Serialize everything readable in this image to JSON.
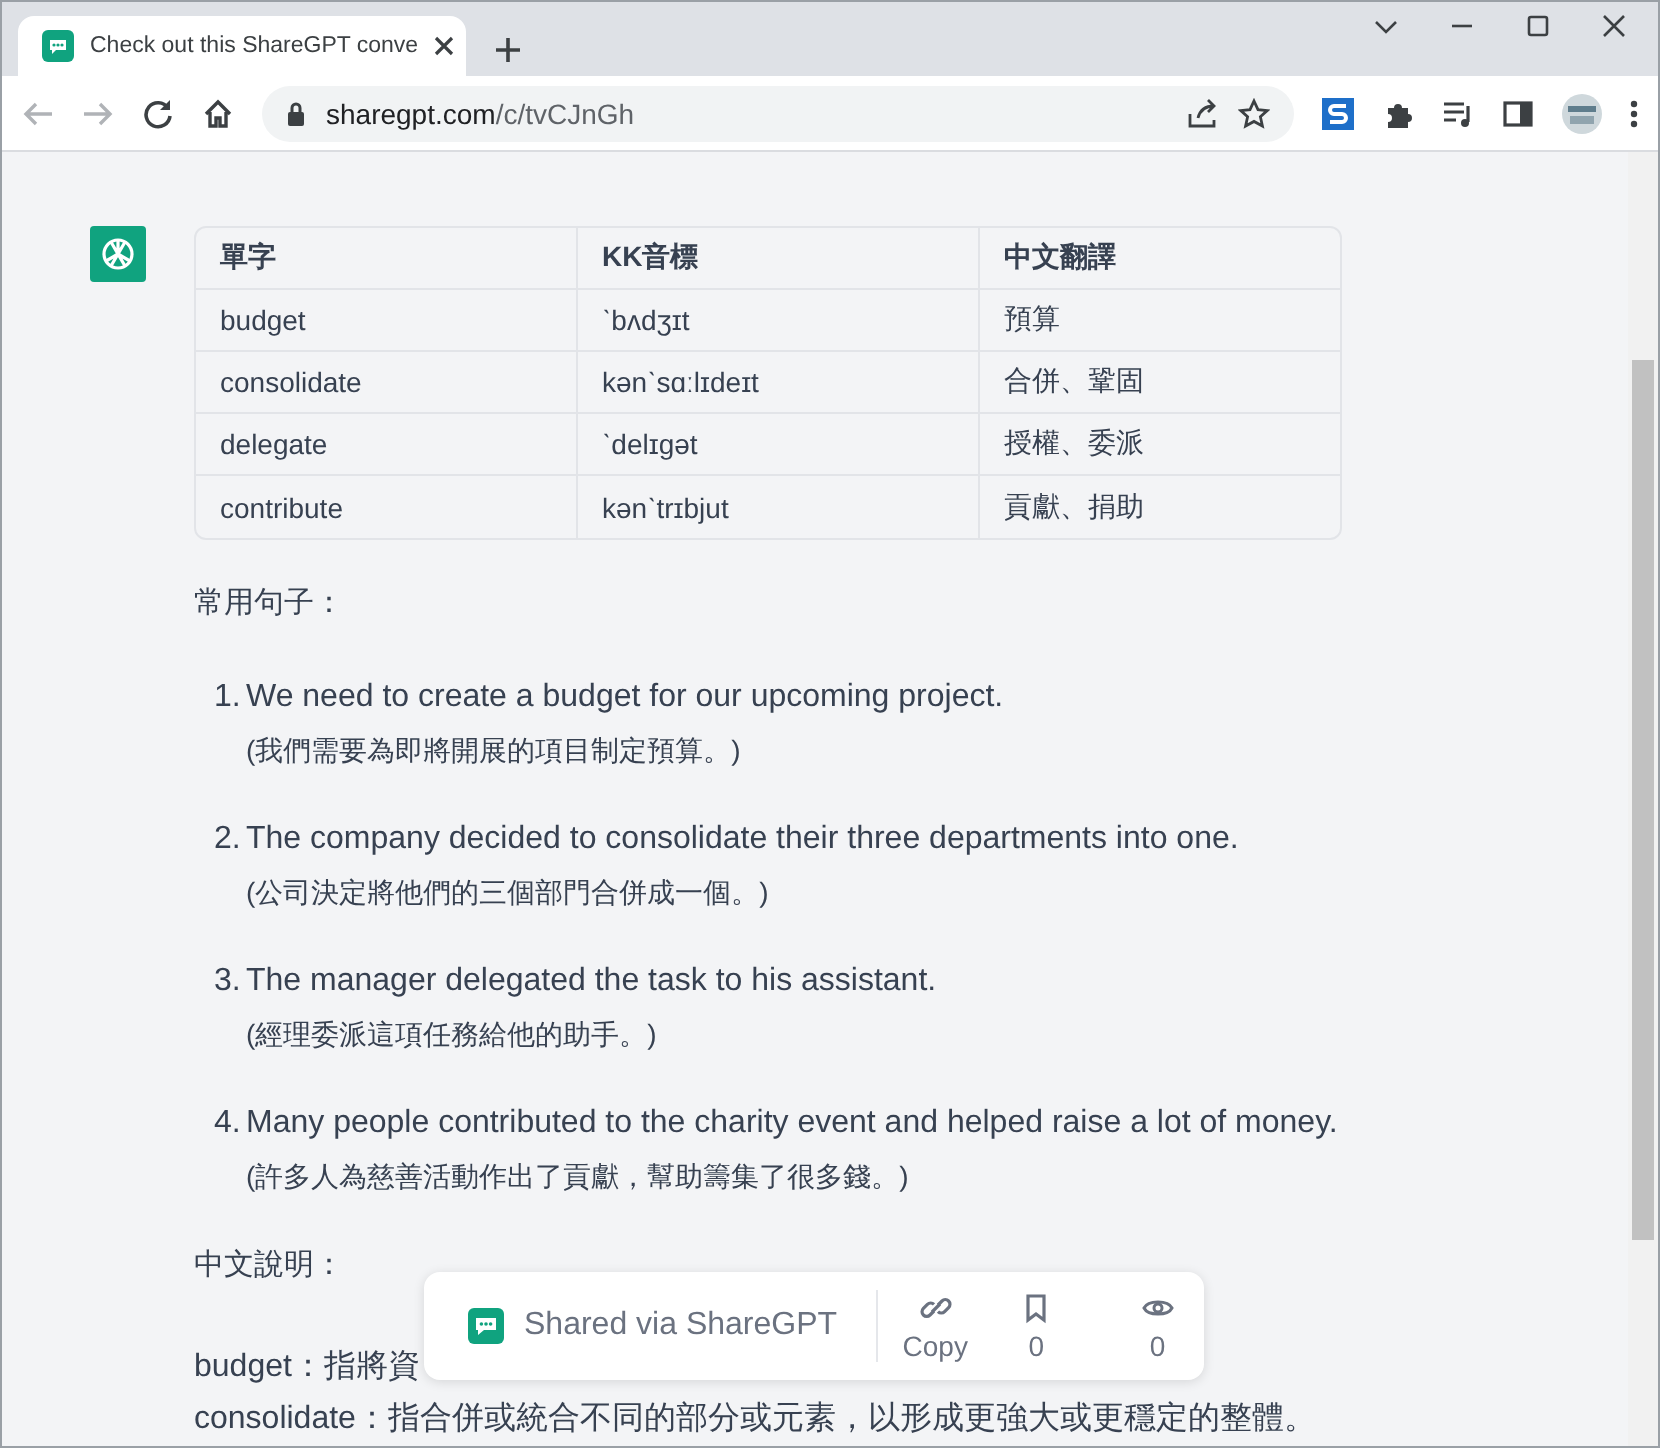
{
  "browser": {
    "tabs": [
      {
        "title": "Check out this ShareGPT conve",
        "selected": true
      }
    ],
    "address": {
      "host": "sharegpt.com",
      "path": "/c/tvCJnGh"
    }
  },
  "message": {
    "table": {
      "columns": [
        "單字",
        "KK音標",
        "中文翻譯"
      ],
      "rows": [
        [
          "budget",
          "ˋbʌdʒɪt",
          "預算"
        ],
        [
          "consolidate",
          "kənˋsɑːlɪdeɪt",
          "合併、鞏固"
        ],
        [
          "delegate",
          "ˋdelɪgət",
          "授權、委派"
        ],
        [
          "contribute",
          "kənˋtrɪbjut",
          "貢獻、捐助"
        ]
      ]
    },
    "sentences_heading": "常用句子：",
    "sentences": [
      {
        "number": "1.",
        "english": "We need to create a budget for our upcoming project.",
        "chinese": "(我們需要為即將開展的項目制定預算。)"
      },
      {
        "number": "2.",
        "english": "The company decided to consolidate their three departments into one.",
        "chinese": "(公司決定將他們的三個部門合併成一個。)"
      },
      {
        "number": "3.",
        "english": "The manager delegated the task to his assistant.",
        "chinese": "(經理委派這項任務給他的助手。)"
      },
      {
        "number": "4.",
        "english": "Many people contributed to the charity event and helped raise a lot of money.",
        "chinese": "(許多人為慈善活動作出了貢獻，幫助籌集了很多錢。)"
      }
    ],
    "explanation_heading": "中文說明：",
    "explanations": [
      "budget：指將資",
      "consolidate：指合併或統合不同的部分或元素，以形成更強大或更穩定的整體。"
    ]
  },
  "share_bar": {
    "label": "Shared via ShareGPT",
    "actions": [
      {
        "kind": "copy",
        "label": "Copy"
      },
      {
        "kind": "bookmark",
        "label": "0"
      },
      {
        "kind": "views",
        "label": "0"
      }
    ]
  }
}
